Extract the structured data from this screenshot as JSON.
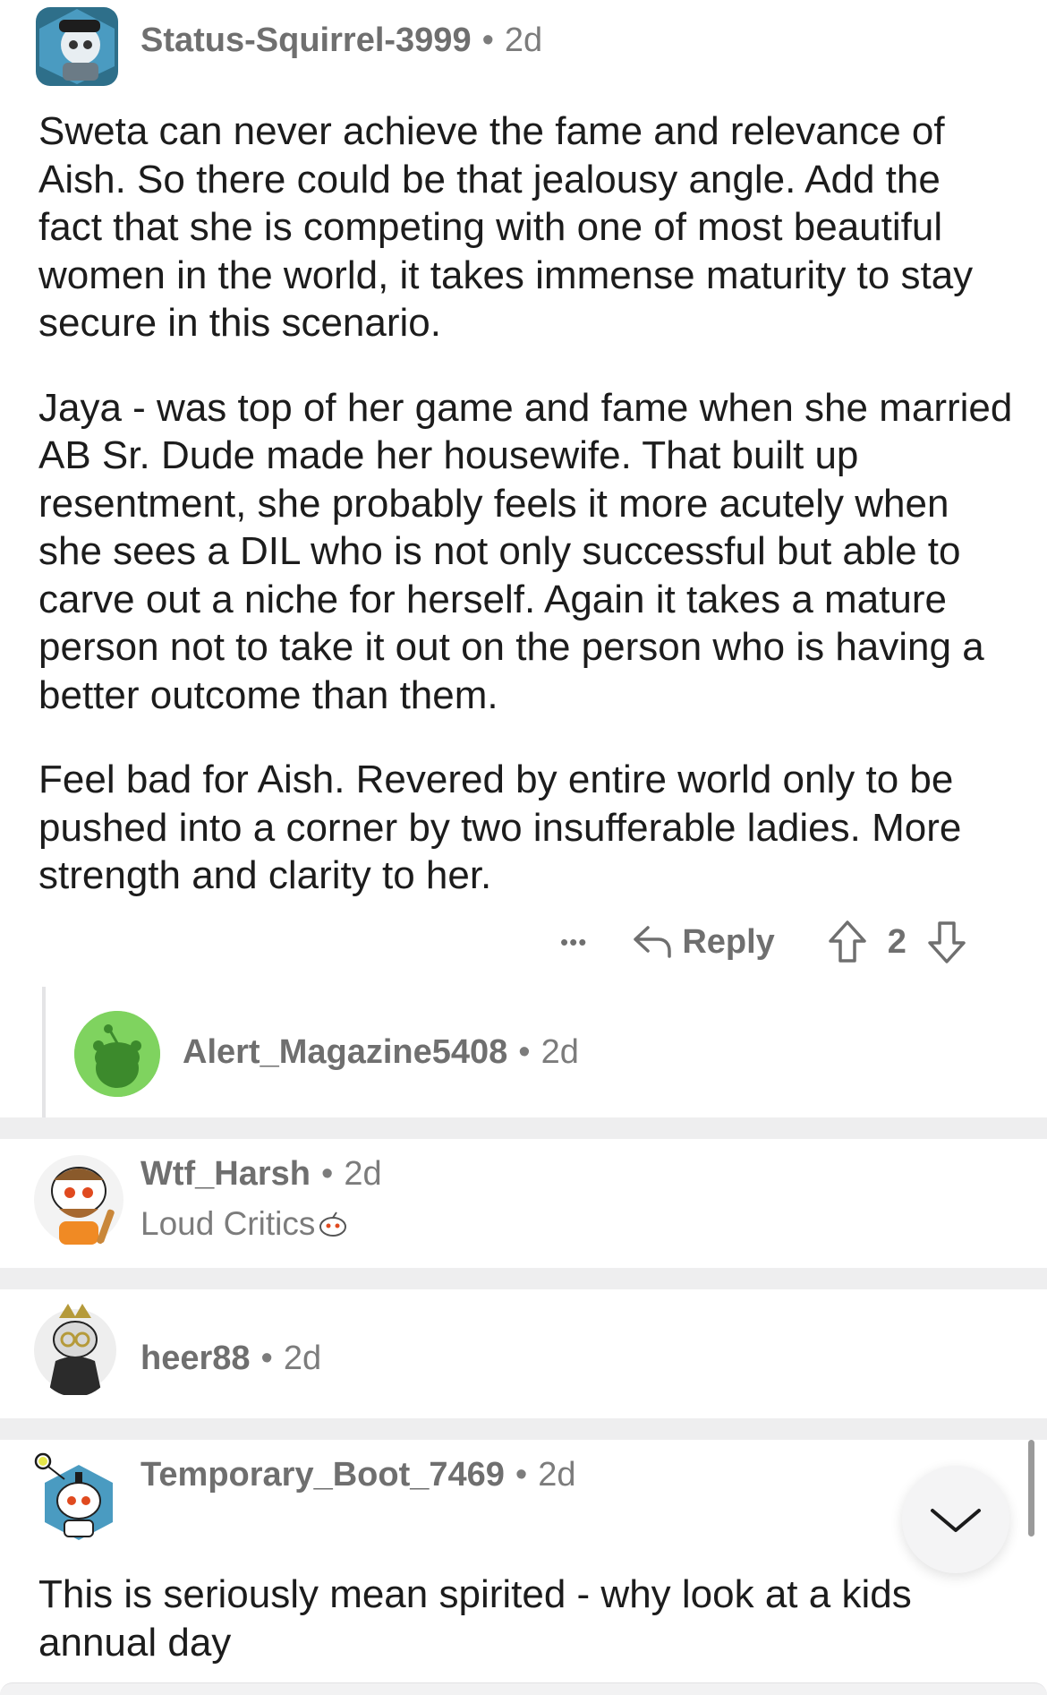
{
  "comments": [
    {
      "username": "Status-Squirrel-3999",
      "age": "2d",
      "paragraphs": [
        "Sweta can never achieve the fame and relevance of Aish. So there could be that jealousy angle. Add the fact that she is competing with one of most beautiful women in the world, it takes immense maturity to stay secure in this scenario.",
        "Jaya - was top of her game and fame when she married AB Sr. Dude made her housewife. That built up resentment, she probably feels it more acutely when she sees a DIL who is not only successful but able to carve out a niche for herself. Again it takes a mature person not to take it out on the person who is having a better outcome than them.",
        "Feel bad for Aish. Revered by entire world only to be pushed into a corner by two insufferable ladies. More strength and clarity to her."
      ],
      "actions": {
        "more_label": "•••",
        "reply_label": "Reply",
        "score": "2"
      }
    },
    {
      "username": "Alert_Magazine5408",
      "age": "2d"
    },
    {
      "username": "Wtf_Harsh",
      "age": "2d",
      "flair": "Loud Critics"
    },
    {
      "username": "heer88",
      "age": "2d"
    },
    {
      "username": "Temporary_Boot_7469",
      "age": "2d",
      "paragraphs": [
        "This is seriously mean spirited - why look at a kids annual day"
      ]
    }
  ],
  "separator": "•",
  "icons": {
    "reply": "reply-arrow-icon",
    "upvote": "upvote-arrow-icon",
    "downvote": "downvote-arrow-icon",
    "more": "more-dots-icon",
    "scroll_down": "chevron-down-icon",
    "flair_emoji": "snoo-emoji-icon"
  },
  "colors": {
    "text": "#1c1c1c",
    "meta": "#6f6f6f",
    "gap": "#eeeeef",
    "default_avatar": "#7fd35f"
  }
}
